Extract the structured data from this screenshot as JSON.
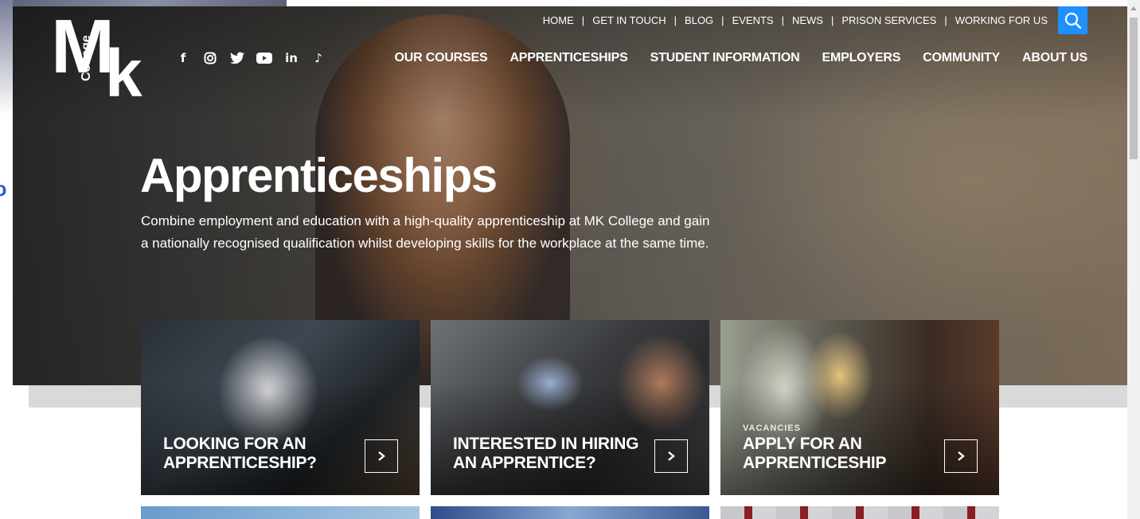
{
  "logo": {
    "letters_m": "M",
    "letters_k": "k",
    "college": "College"
  },
  "social": [
    {
      "icon": "facebook-icon",
      "glyph": "f"
    },
    {
      "icon": "instagram-icon",
      "glyph": "◎"
    },
    {
      "icon": "twitter-icon",
      "glyph": "🐦"
    },
    {
      "icon": "youtube-icon",
      "glyph": "▶"
    },
    {
      "icon": "linkedin-icon",
      "glyph": "in"
    },
    {
      "icon": "tiktok-icon",
      "glyph": "♪"
    }
  ],
  "util_nav": [
    "HOME",
    "GET IN TOUCH",
    "BLOG",
    "EVENTS",
    "NEWS",
    "PRISON SERVICES",
    "WORKING FOR US"
  ],
  "main_nav": [
    "OUR COURSES",
    "APPRENTICESHIPS",
    "STUDENT INFORMATION",
    "EMPLOYERS",
    "COMMUNITY",
    "ABOUT US"
  ],
  "hero": {
    "title": "Apprenticeships",
    "description": "Combine employment and education with a high-quality apprenticeship at MK College and gain a nationally recognised qualification whilst developing skills for the workplace at the same time."
  },
  "cards": [
    {
      "kicker": "",
      "title": "LOOKING FOR AN APPRENTICESHIP?"
    },
    {
      "kicker": "",
      "title": "INTERESTED IN HIRING AN APPRENTICE?"
    },
    {
      "kicker": "VACANCIES",
      "title": "APPLY FOR AN APPRENTICESHIP"
    }
  ],
  "colors": {
    "search_accent": "#1e90ff"
  }
}
